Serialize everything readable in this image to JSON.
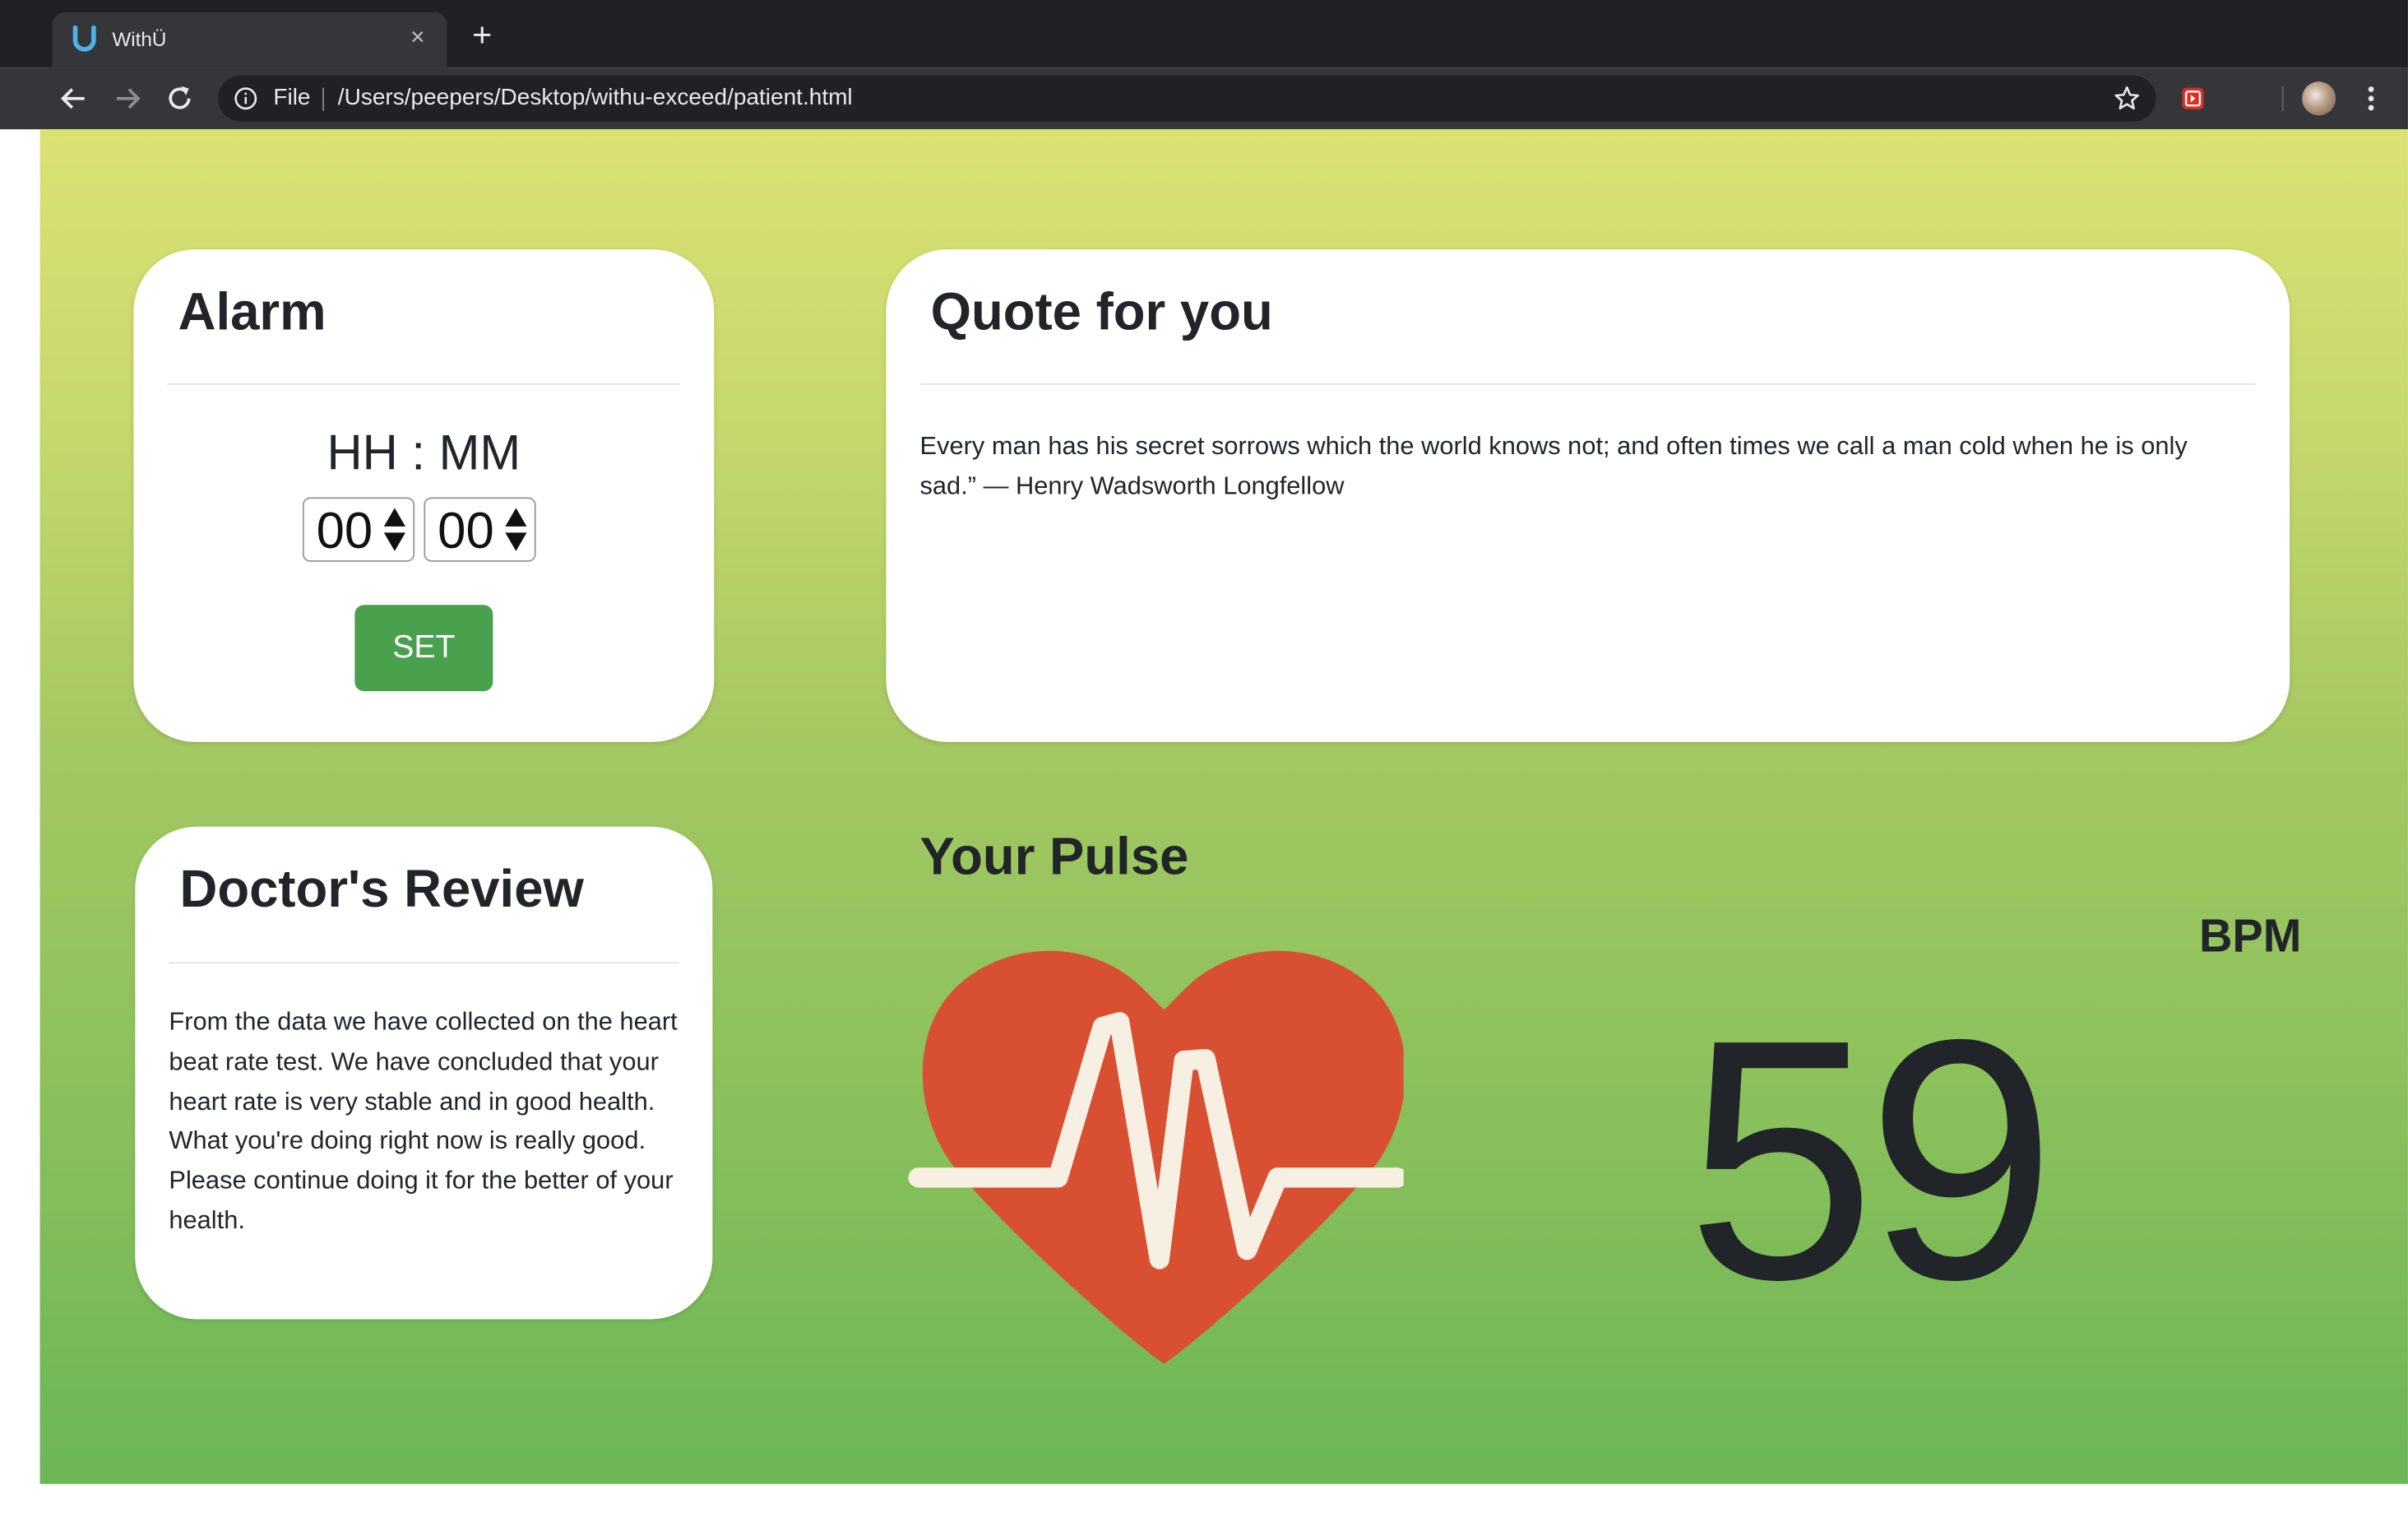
{
  "browser": {
    "tab_title": "WithÜ",
    "tab_close": "×",
    "new_tab": "+",
    "file_label": "File",
    "url": "/Users/peepers/Desktop/withu-exceed/patient.html"
  },
  "alarm": {
    "title": "Alarm",
    "format": "HH : MM",
    "hours": "00",
    "minutes": "00",
    "set_label": "SET"
  },
  "quote": {
    "title": "Quote for you",
    "text": "Every man has his secret sorrows which the world knows not; and often times we call a man cold when he is only sad.” — Henry Wadsworth Longfellow"
  },
  "review": {
    "title": "Doctor's Review",
    "text": "From the data we have collected on the heart beat rate test. We have concluded that your heart rate is very stable and in good health. What you're doing right now is really good. Please continue doing it for the better of your health."
  },
  "pulse": {
    "title": "Your Pulse",
    "unit": "BPM",
    "value": "59"
  },
  "colors": {
    "set_button": "#4aa14d",
    "heart": "#d84f32",
    "gradient_top": "#dce173",
    "gradient_bottom": "#6cb655"
  },
  "icons": [
    "tab-favicon-icon",
    "close-icon",
    "plus-icon",
    "back-arrow-icon",
    "forward-arrow-icon",
    "reload-icon",
    "info-icon",
    "star-icon",
    "extension-icon",
    "avatar",
    "menu-dots-icon",
    "heart-pulse-icon"
  ]
}
